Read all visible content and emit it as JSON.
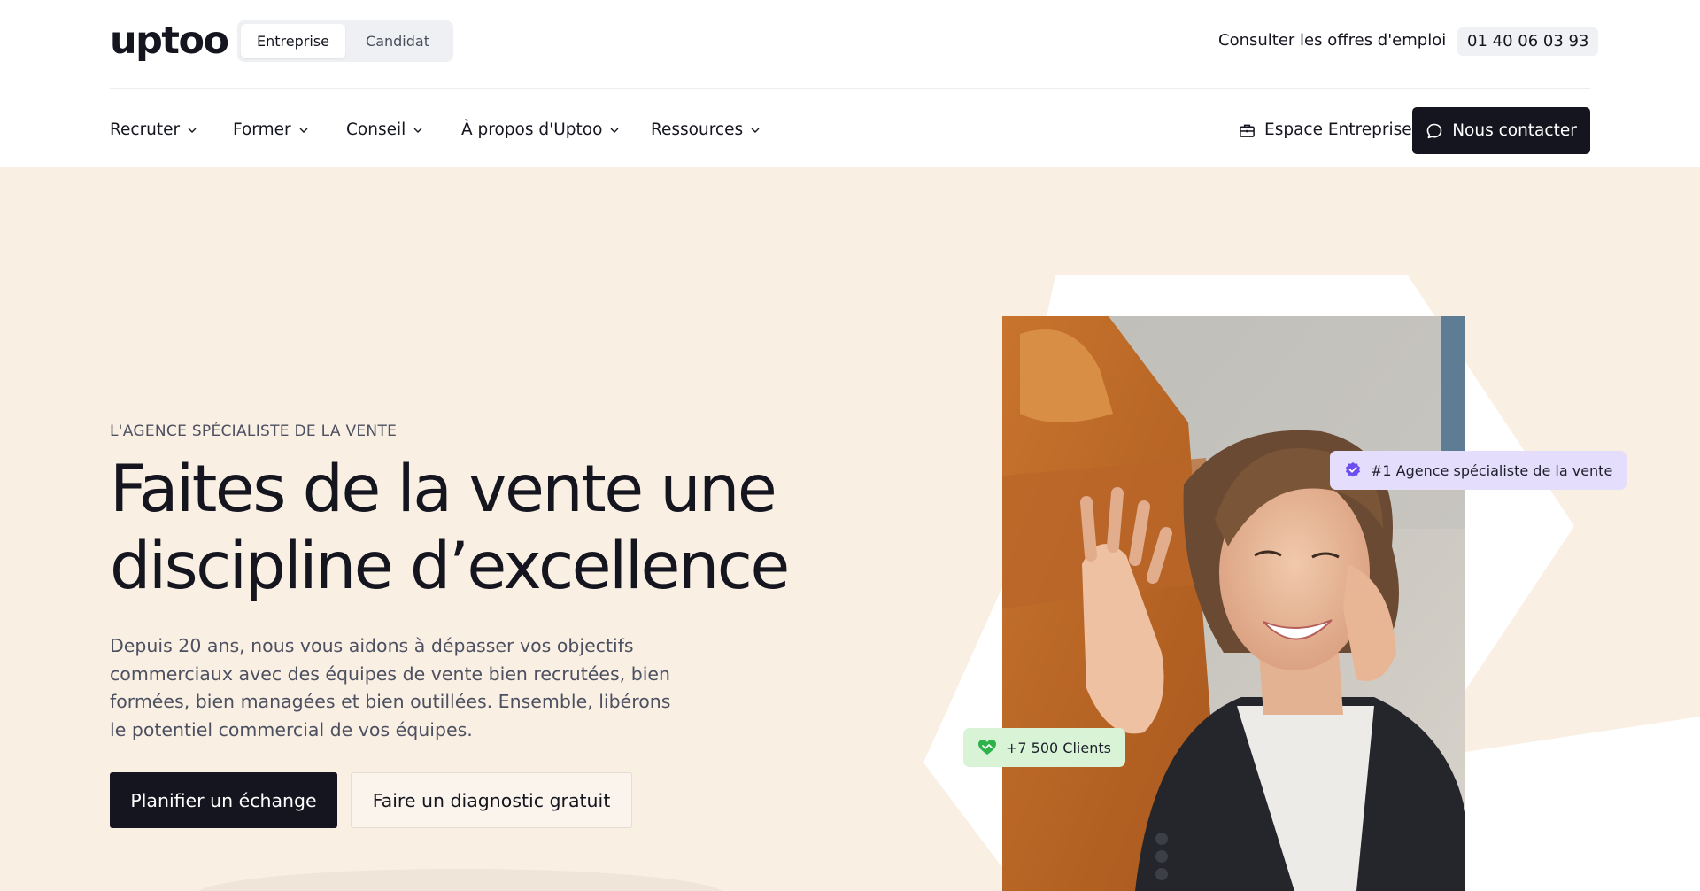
{
  "header": {
    "logo": "uptoo",
    "audience": [
      {
        "label": "Entreprise",
        "active": true
      },
      {
        "label": "Candidat",
        "active": false
      }
    ],
    "jobs_link": "Consulter les offres d'emploi",
    "phone": "01 40 06 03 93"
  },
  "nav": {
    "items": [
      {
        "label": "Recruter"
      },
      {
        "label": "Former"
      },
      {
        "label": "Conseil"
      },
      {
        "label": "À propos d'Uptoo"
      },
      {
        "label": "Ressources"
      }
    ],
    "espace_label": "Espace Entreprise",
    "contact_label": "Nous contacter",
    "icons": [
      "chevron-down-icon",
      "briefcase-icon",
      "chat-bubble-icon"
    ]
  },
  "hero": {
    "eyebrow": "L'AGENCE SPÉCIALISTE DE LA VENTE",
    "title_line1": "Faites de la vente une",
    "title_line2": "discipline d’excellence",
    "lead": "Depuis 20 ans, nous vous aidons à dépasser vos objectifs commerciaux avec des équipes de vente bien recrutées, bien formées, bien managées et bien outillées. Ensemble, libérons le potentiel commercial de vos équipes.",
    "primary_cta": "Planifier un échange",
    "secondary_cta": "Faire un diagnostic gratuit",
    "badge_top": "#1 Agence spécialiste de la vente",
    "badge_bottom": "+7 500 Clients",
    "photo_icon": "woman-on-phone-photo"
  },
  "colors": {
    "hero_bg": "#f9efe3",
    "dark": "#14151f",
    "badge_purple": "#e4ddfb",
    "badge_green": "#d8f3d6",
    "accent_purple": "#6b4df0",
    "accent_green": "#2fb24c"
  }
}
